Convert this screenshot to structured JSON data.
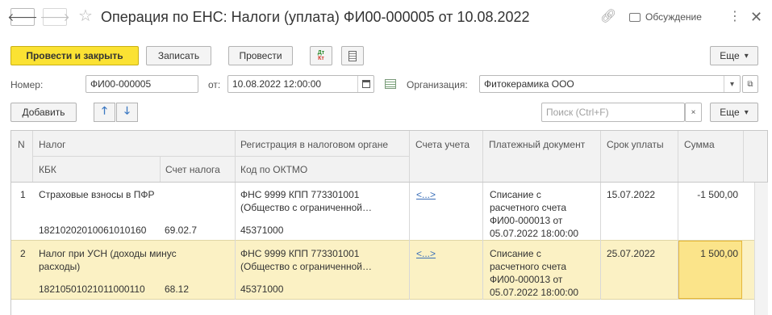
{
  "header": {
    "back_icon": "arrow-left-icon",
    "forward_icon": "arrow-right-icon",
    "star_icon": "star-icon",
    "title": "Операция по ЕНС: Налоги (уплата) ФИ00-000005 от 10.08.2022",
    "link_icon": "link-icon",
    "discuss_label": "Обсуждение",
    "more_icon": "kebab-icon",
    "close_icon": "close-icon"
  },
  "toolbar": {
    "post_close_label": "Провести и закрыть",
    "save_label": "Записать",
    "post_label": "Провести",
    "dtkt_top": "Дт",
    "dtkt_bottom": "Кт",
    "more_label": "Еще"
  },
  "form": {
    "number_label": "Номер:",
    "number_value": "ФИ00-000005",
    "date_label": "от:",
    "date_value": "10.08.2022 12:00:00",
    "org_label": "Организация:",
    "org_value": "Фитокерамика ООО"
  },
  "table_toolbar": {
    "add_label": "Добавить",
    "search_placeholder": "Поиск (Ctrl+F)",
    "clear_symbol": "×",
    "more_label": "Еще"
  },
  "table": {
    "headers": {
      "n": "N",
      "tax": "Налог",
      "kbk": "КБК",
      "tax_account": "Счет налога",
      "registration": "Регистрация в налоговом органе",
      "oktmo": "Код по ОКТМО",
      "accounts": "Счета учета",
      "payment_doc": "Платежный документ",
      "due_date": "Срок уплаты",
      "amount": "Сумма"
    },
    "rows": [
      {
        "n": "1",
        "tax_line1": "Страховые взносы в ПФР",
        "tax_line2": "",
        "kbk": "18210202010061010160",
        "tax_account": "69.02.7",
        "reg_line1": "ФНС 9999 КПП 773301001",
        "reg_line2": "(Общество с ограниченной…",
        "oktmo": "45371000",
        "accounts": "<...>",
        "pay_line1": "Списание с",
        "pay_line2": "расчетного счета",
        "pay_line3": "ФИ00-000013 от",
        "pay_line4": "05.07.2022 18:00:00",
        "due_date": "15.07.2022",
        "amount": "-1 500,00"
      },
      {
        "n": "2",
        "tax_line1": "Налог при УСН (доходы минус",
        "tax_line2": "расходы)",
        "kbk": "18210501021011000110",
        "tax_account": "68.12",
        "reg_line1": "ФНС 9999 КПП 773301001",
        "reg_line2": "(Общество с ограниченной…",
        "oktmo": "45371000",
        "accounts": "<...>",
        "pay_line1": "Списание с",
        "pay_line2": "расчетного счета",
        "pay_line3": "ФИ00-000013 от",
        "pay_line4": "05.07.2022 18:00:00",
        "due_date": "25.07.2022",
        "amount": "1 500,00"
      }
    ]
  },
  "colors": {
    "primary_button": "#fbe233",
    "selected_row": "#fbf1c4",
    "selected_cell": "#fbe48a",
    "link": "#3b6fb8",
    "arrow_icons": "#3b78c2"
  }
}
